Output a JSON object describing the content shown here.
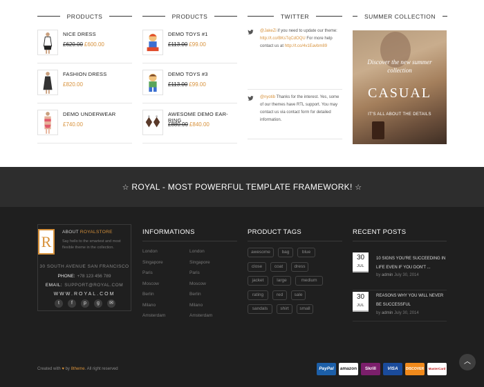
{
  "products_col1": {
    "title": "PRODUCTS",
    "items": [
      {
        "name": "NICE DRESS",
        "old_price": "£620.00",
        "price": "£600.00"
      },
      {
        "name": "FASHION DRESS",
        "old_price": "",
        "price": "£820.00"
      },
      {
        "name": "DEMO UNDERWEAR",
        "old_price": "",
        "price": "£740.00"
      }
    ]
  },
  "products_col2": {
    "title": "PRODUCTS",
    "items": [
      {
        "name": "DEMO TOYS #1",
        "old_price": "£113.00",
        "price": "£99.00"
      },
      {
        "name": "DEMO TOYS #3",
        "old_price": "£113.00",
        "price": "£99.00"
      },
      {
        "name": "AWESOME DEMO EAR-RING",
        "old_price": "£880.00",
        "price": "£840.00"
      }
    ]
  },
  "twitter": {
    "title": "TWITTER",
    "tweets": [
      {
        "handle": "@JakeZi",
        "text": " if you need to update our theme: ",
        "link": "http://t.co/BKsTqCdOQU",
        "rest": " For more help contact us at ",
        "link2": "http://t.co/4v1Eavbm89"
      },
      {
        "handle": "@nyotib",
        "text": " Thanks for the interest. Yes, some of our themes have RTL support. You may contact us via contact form for detailed information."
      }
    ]
  },
  "summer": {
    "title": "SUMMER COLLECTION",
    "banner_line1": "Discover the new summer",
    "banner_line2": "collection",
    "banner_big": "CASUAL",
    "banner_sub": "IT'S ALL ABOUT THE DETAILS"
  },
  "band": {
    "title": "ROYAL - MOST POWERFUL TEMPLATE FRAMEWORK!",
    "star": "☆"
  },
  "about": {
    "logo_letter": "R",
    "heading_prefix": "ABOUT ",
    "heading_brand": "ROYALSTORE",
    "desc": "Say hello to the smartest and most flexible theme in the collection.",
    "address": "30 SOUTH AVENUE SAN FRANCISCO",
    "phone_label": "PHONE:",
    "phone": "+78 123 456 789",
    "email_label": "EMAIL:",
    "email": "SUPPORT@ROYAL.COM",
    "website": "WWW.ROYAL.COM",
    "social_icons": [
      "twitter-icon",
      "facebook-icon",
      "pinterest-icon",
      "google-plus-icon",
      "mail-icon"
    ]
  },
  "informations": {
    "title": "INFORMATIONS",
    "col1": [
      "London",
      "Singapore",
      "Paris",
      "Moscow",
      "Berlin",
      "Milano",
      "Amsterdam"
    ],
    "col2": [
      "London",
      "Singapore",
      "Paris",
      "Moscow",
      "Berlin",
      "Milano",
      "Amsterdam"
    ]
  },
  "tags": {
    "title": "PRODUCT TAGS",
    "rows": [
      [
        "awesome",
        "bag",
        "blue"
      ],
      [
        "close",
        "coat",
        "dress"
      ],
      [
        "jacket",
        "large",
        "medium"
      ],
      [
        "rating",
        "red",
        "sale"
      ],
      [
        "sandals",
        "shirt",
        "small"
      ]
    ]
  },
  "recent_posts": {
    "title": "RECENT POSTS",
    "posts": [
      {
        "day": "30",
        "month": "JUL",
        "title": "10 SIGNS YOU'RE SUCCEEDING IN LIFE EVEN IF YOU DON'T ...",
        "by": "by ",
        "author": "admin",
        "date": " July 30, 2014"
      },
      {
        "day": "30",
        "month": "JUL",
        "title": "REASONS WHY YOU WILL NEVER BE SUCCESSFUL",
        "by": "by ",
        "author": "admin",
        "date": " July 30, 2014"
      }
    ]
  },
  "credit": {
    "prefix": "Created with ",
    "heart": "♥",
    "by": " by ",
    "brand": "8theme",
    "suffix": ". All right reserved"
  },
  "payments": [
    "PayPal",
    "amazon",
    "Skrill",
    "VISA",
    "DISCOVER",
    "MasterCard"
  ],
  "colors": {
    "accent": "#d7913a",
    "band": "#2d2d2d",
    "footer": "#1f1f1f"
  }
}
